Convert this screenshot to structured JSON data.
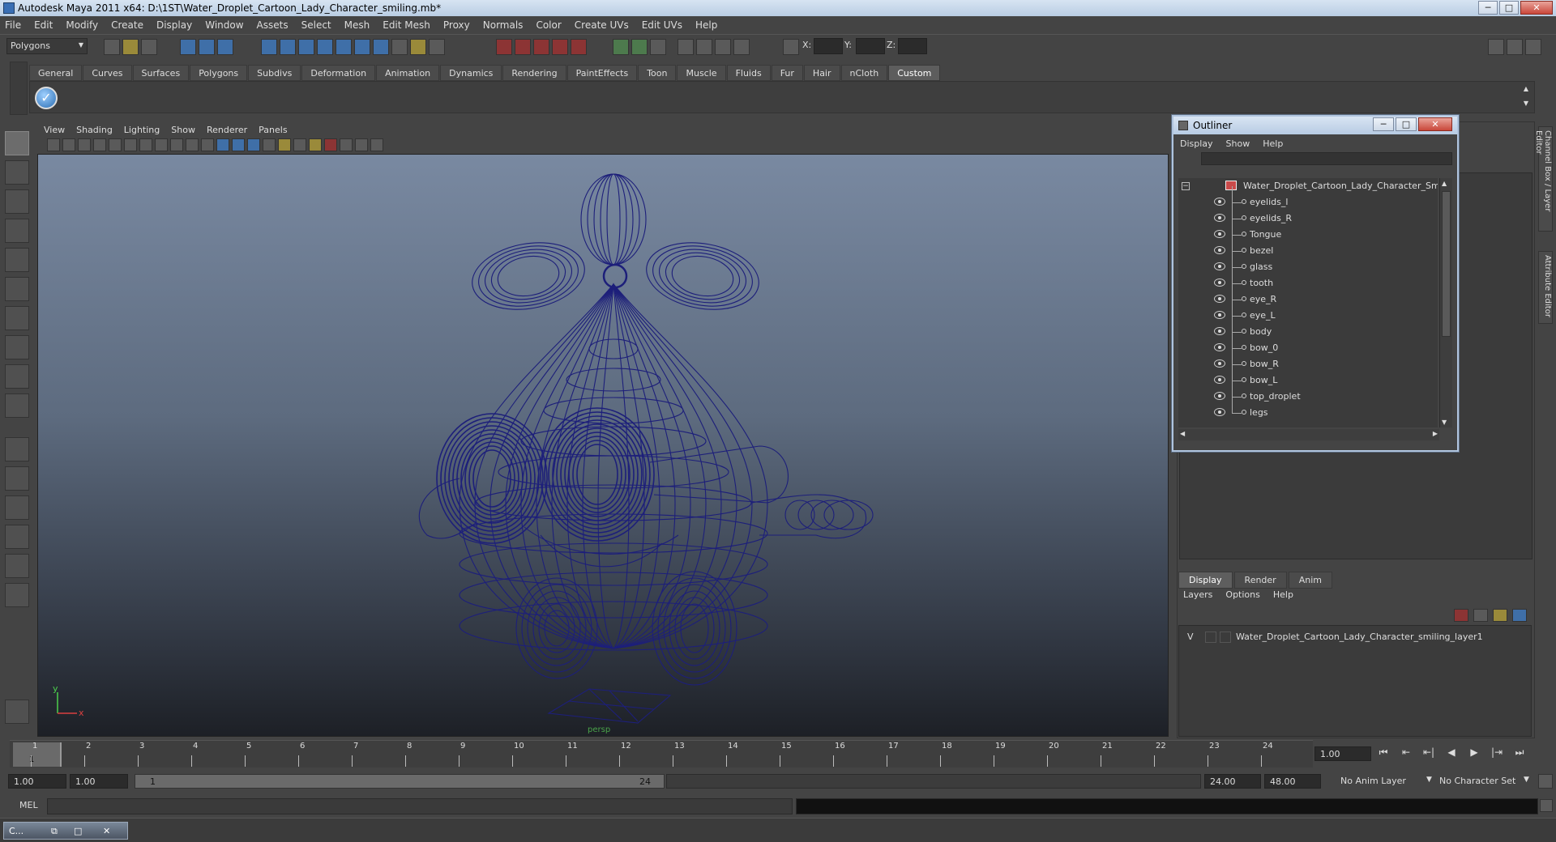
{
  "window": {
    "title": "Autodesk Maya 2011 x64: D:\\1ST\\Water_Droplet_Cartoon_Lady_Character_smiling.mb*",
    "minimize": "─",
    "maximize": "□",
    "close": "✕"
  },
  "menubar": [
    "File",
    "Edit",
    "Modify",
    "Create",
    "Display",
    "Window",
    "Assets",
    "Select",
    "Mesh",
    "Edit Mesh",
    "Proxy",
    "Normals",
    "Color",
    "Create UVs",
    "Edit UVs",
    "Help"
  ],
  "statusline": {
    "mode": "Polygons",
    "x_label": "X:",
    "y_label": "Y:",
    "z_label": "Z:"
  },
  "shelf": {
    "tabs": [
      "General",
      "Curves",
      "Surfaces",
      "Polygons",
      "Subdivs",
      "Deformation",
      "Animation",
      "Dynamics",
      "Rendering",
      "PaintEffects",
      "Toon",
      "Muscle",
      "Fluids",
      "Fur",
      "Hair",
      "nCloth",
      "Custom"
    ],
    "active": "Custom",
    "custom_icon": "✓"
  },
  "viewport": {
    "menu": [
      "View",
      "Shading",
      "Lighting",
      "Show",
      "Renderer",
      "Panels"
    ],
    "camera": "persp",
    "axis_x": "x",
    "axis_y": "y",
    "wire_color": "#1d1f7a"
  },
  "outliner": {
    "title": "Outliner",
    "menu": [
      "Display",
      "Show",
      "Help"
    ],
    "root": "Water_Droplet_Cartoon_Lady_Character_Smiling",
    "expand_glyph": "−",
    "children": [
      "eyelids_l",
      "eyelids_R",
      "Tongue",
      "bezel",
      "glass",
      "tooth",
      "eye_R",
      "eye_L",
      "body",
      "bow_0",
      "bow_R",
      "bow_L",
      "top_droplet",
      "legs"
    ]
  },
  "side_tabs": [
    "Channel Box / Layer Editor",
    "Attribute Editor"
  ],
  "layer_editor": {
    "tabs": [
      "Display",
      "Render",
      "Anim"
    ],
    "active": "Display",
    "menu": [
      "Layers",
      "Options",
      "Help"
    ],
    "layer": {
      "visible": "V",
      "name": "Water_Droplet_Cartoon_Lady_Character_smiling_layer1"
    }
  },
  "timeline": {
    "ticks": [
      "1",
      "2",
      "3",
      "4",
      "5",
      "6",
      "7",
      "8",
      "9",
      "10",
      "11",
      "12",
      "13",
      "14",
      "15",
      "16",
      "17",
      "18",
      "19",
      "20",
      "21",
      "22",
      "23",
      "24"
    ],
    "current_marker": "1",
    "current_time": "1.00",
    "playback": [
      "⏮",
      "⇤",
      "⇤|",
      "◀",
      "▶",
      "|⇥",
      "⏭"
    ]
  },
  "range": {
    "start": "1.00",
    "playback_start": "1.00",
    "slider_start": "1",
    "slider_end": "24",
    "playback_end": "24.00",
    "end": "48.00",
    "anim_layer": "No Anim Layer",
    "char_set": "No Character Set"
  },
  "cmdline": {
    "label": "MEL"
  },
  "taskbar": {
    "item": "C...",
    "restore": "⧉",
    "maximize": "□",
    "close": "✕"
  }
}
